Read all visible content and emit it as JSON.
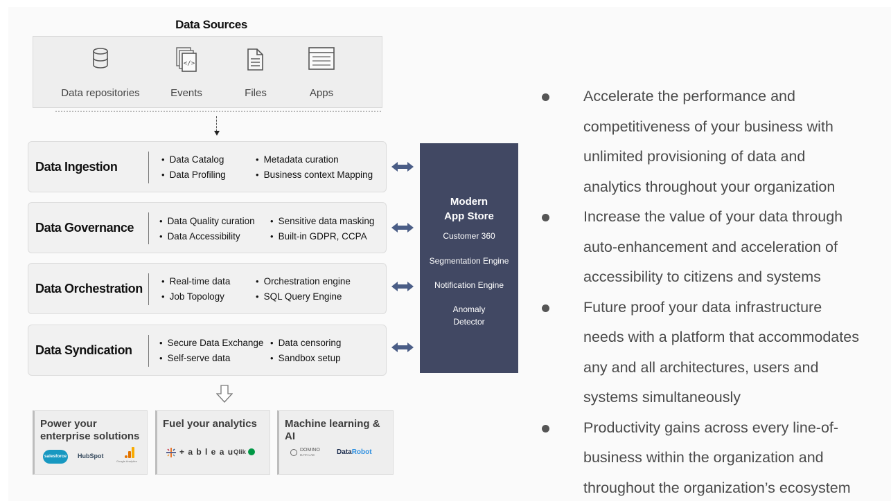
{
  "data_sources": {
    "title": "Data Sources",
    "items": [
      {
        "label": "Data repositories",
        "icon": "database-icon"
      },
      {
        "label": "Events",
        "icon": "code-files-icon"
      },
      {
        "label": "Files",
        "icon": "file-icon"
      },
      {
        "label": "Apps",
        "icon": "app-window-icon"
      }
    ]
  },
  "layers": [
    {
      "title": "Data Ingestion",
      "left_items": [
        "Data Catalog",
        "Data Profiling"
      ],
      "right_items": [
        "Metadata curation",
        "Business context Mapping"
      ]
    },
    {
      "title": "Data Governance",
      "left_items": [
        "Data Quality curation",
        "Data Accessibility"
      ],
      "right_items": [
        "Sensitive data masking",
        "Built-in GDPR, CCPA"
      ]
    },
    {
      "title": "Data Orchestration",
      "left_items": [
        "Real-time data",
        "Job Topology"
      ],
      "right_items": [
        "Orchestration engine",
        "SQL Query Engine"
      ]
    },
    {
      "title": "Data Syndication",
      "left_items": [
        "Secure Data Exchange",
        "Self-serve data"
      ],
      "right_items": [
        "Data censoring",
        "Sandbox setup"
      ]
    }
  ],
  "app_store": {
    "title_line1": "Modern",
    "title_line2": "App Store",
    "items": [
      "Customer 360",
      "Segmentation Engine",
      "Notification Engine",
      "Anomaly",
      "Detector"
    ]
  },
  "outcomes": [
    {
      "title_line1": "Power your",
      "title_line2": "enterprise solutions",
      "logos": [
        "salesforce",
        "HubSpot",
        "Google Analytics"
      ]
    },
    {
      "title_line1": "Fuel your analytics",
      "title_line2": "",
      "logos": [
        "+ a b l e a u",
        "Qlik"
      ]
    },
    {
      "title_line1": "Machine learning &",
      "title_line2": "AI",
      "logos": [
        "DOMINO",
        "DATA LAB",
        "Data",
        "Robot"
      ]
    }
  ],
  "benefits": [
    {
      "lines": [
        "Accelerate the performance and",
        "competitiveness of your business with",
        "unlimited provisioning of data and",
        "analytics throughout your organization"
      ]
    },
    {
      "lines": [
        "Increase the value of your data through",
        "auto-enhancement and acceleration of",
        "accessibility to citizens and systems"
      ]
    },
    {
      "lines": [
        "Future proof your data infrastructure",
        "needs with a platform that accommodates",
        "any and all architectures, users and",
        "systems simultaneously"
      ]
    },
    {
      "lines": [
        "Productivity gains across every line-of-",
        "business within the organization and",
        "throughout the organization’s ecosystem"
      ]
    }
  ],
  "colors": {
    "app_store_bg": "#414863",
    "arrow": "#4a5d86",
    "benefit_text": "#4a4a4a"
  }
}
